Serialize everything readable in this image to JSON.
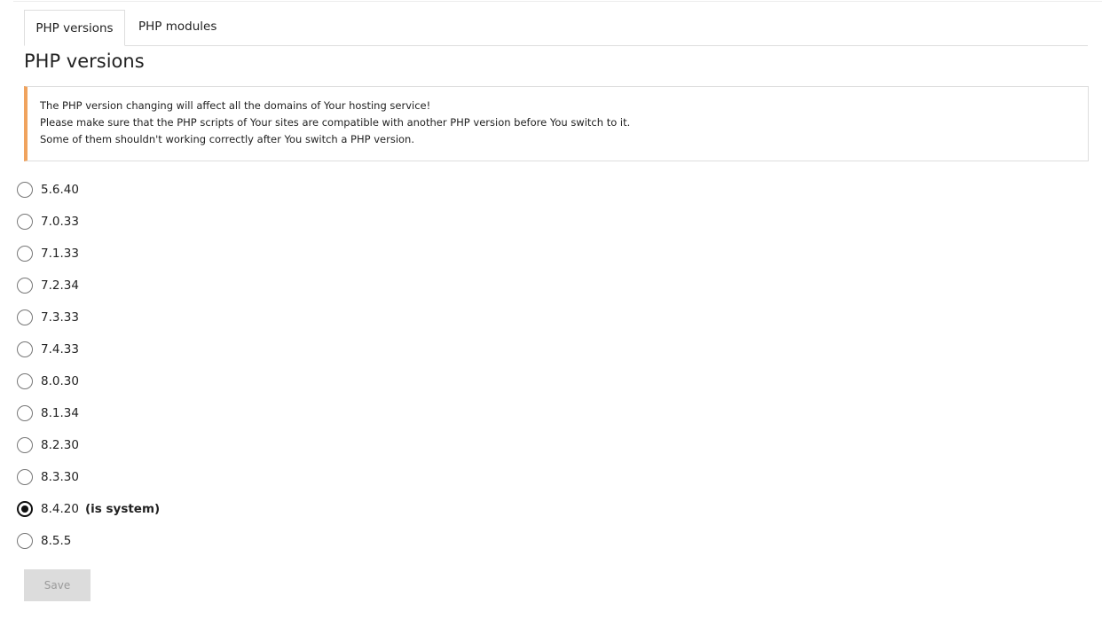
{
  "tabs": [
    {
      "label": "PHP versions",
      "active": true
    },
    {
      "label": "PHP modules",
      "active": false
    }
  ],
  "page_title": "PHP versions",
  "notice": {
    "lines": [
      "The PHP version changing will affect all the domains of Your hosting service!",
      "Please make sure that the PHP scripts of Your sites are compatible with another PHP version before You switch to it.",
      "Some of them shouldn't working correctly after You switch a PHP version."
    ],
    "accent_color": "#f0a35e"
  },
  "versions": [
    {
      "label": "5.6.40",
      "checked": false,
      "note": ""
    },
    {
      "label": "7.0.33",
      "checked": false,
      "note": ""
    },
    {
      "label": "7.1.33",
      "checked": false,
      "note": ""
    },
    {
      "label": "7.2.34",
      "checked": false,
      "note": ""
    },
    {
      "label": "7.3.33",
      "checked": false,
      "note": ""
    },
    {
      "label": "7.4.33",
      "checked": false,
      "note": ""
    },
    {
      "label": "8.0.30",
      "checked": false,
      "note": ""
    },
    {
      "label": "8.1.34",
      "checked": false,
      "note": ""
    },
    {
      "label": "8.2.30",
      "checked": false,
      "note": ""
    },
    {
      "label": "8.3.30",
      "checked": false,
      "note": ""
    },
    {
      "label": "8.4.20",
      "checked": true,
      "note": "(is system)"
    },
    {
      "label": "8.5.5",
      "checked": false,
      "note": ""
    }
  ],
  "save_button": {
    "label": "Save",
    "disabled": true
  }
}
